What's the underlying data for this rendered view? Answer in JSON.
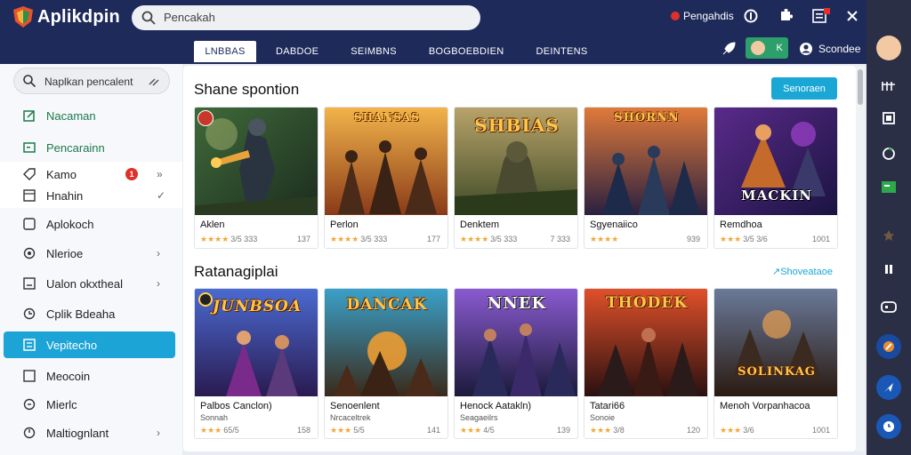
{
  "app": {
    "name": "Aplikdpin"
  },
  "search_top": {
    "placeholder": "Pencakah"
  },
  "header_right": {
    "notify_label": "Pengahdis"
  },
  "tabs": [
    {
      "label": "LNBBAS"
    },
    {
      "label": "DABDOE"
    },
    {
      "label": "SEIMBNS"
    },
    {
      "label": "BOGBOEBDIEN"
    },
    {
      "label": "DEINTENS"
    }
  ],
  "user": {
    "chip_letter": "K",
    "name": "Scondee"
  },
  "sidebar": {
    "search_placeholder": "Naplkan pencalent",
    "items": [
      {
        "label": "Nacaman",
        "icon": "edit-icon"
      },
      {
        "label": "Pencarainn",
        "icon": "message-icon"
      },
      {
        "label": "Kamo",
        "icon": "tag-icon",
        "badge": "1"
      },
      {
        "label": "Hnahin",
        "icon": "grid-icon"
      },
      {
        "label": "Aplokoch",
        "icon": "apps-icon"
      },
      {
        "label": "Nlerioe",
        "icon": "gear-icon"
      },
      {
        "label": "Ualon okxtheal",
        "icon": "list-icon"
      },
      {
        "label": "Cplik Bdeaha",
        "icon": "history-icon"
      },
      {
        "label": "Vepitecho",
        "icon": "folder-icon"
      },
      {
        "label": "Meocoin",
        "icon": "download-icon"
      },
      {
        "label": "Mierlc",
        "icon": "bell-icon"
      },
      {
        "label": "Maltiognlant",
        "icon": "settings-icon"
      }
    ]
  },
  "section1": {
    "title": "Shane spontion",
    "cta": "Senoraen",
    "cards": [
      {
        "name": "Aklen",
        "stars": "★★★★",
        "rating": "3/5 333",
        "meta": "137"
      },
      {
        "name": "Perlon",
        "stars": "★★★★",
        "rating": "3/5 333",
        "meta": "177",
        "art": "SHANSAS"
      },
      {
        "name": "Denktem",
        "stars": "★★★★",
        "rating": "3/5 333",
        "meta": "7 333",
        "art": "SHBIAS"
      },
      {
        "name": "Sgyenaiico",
        "stars": "★★★★",
        "rating": "",
        "meta": "939",
        "art": "SHORNN"
      },
      {
        "name": "Remdhoa",
        "stars": "★★★",
        "rating": "3/5 3/6",
        "meta": "1001",
        "art": "MACKIN"
      }
    ]
  },
  "section2": {
    "title": "Ratanagiplai",
    "see_all": "Shoveataoe",
    "cards": [
      {
        "name": "Palbos Canclon)",
        "sub": "Sonnah",
        "stars": "★★★",
        "rating": "65/5",
        "meta": "158",
        "art": "JUNBSOA"
      },
      {
        "name": "Senoenlent",
        "sub": "Nrcaceltrek",
        "stars": "★★★",
        "rating": "5/5",
        "meta": "141",
        "art": "DANCAK"
      },
      {
        "name": "Henock Aatakln)",
        "sub": "Seagaeilrs",
        "stars": "★★★",
        "rating": "4/5",
        "meta": "139",
        "art": "NNEK"
      },
      {
        "name": "Tatari66",
        "sub": "Sonoie",
        "stars": "★★★",
        "rating": "3/8",
        "meta": "120",
        "art": "THODEK"
      },
      {
        "name": "Menoh Vorpanhacoa",
        "sub": "",
        "stars": "★★★",
        "rating": "3/6",
        "meta": "1001",
        "art": "SOLINKAG"
      }
    ]
  },
  "colors": {
    "header": "#1e2a5a",
    "accent": "#1da4d6",
    "rail": "#2a2f45"
  }
}
